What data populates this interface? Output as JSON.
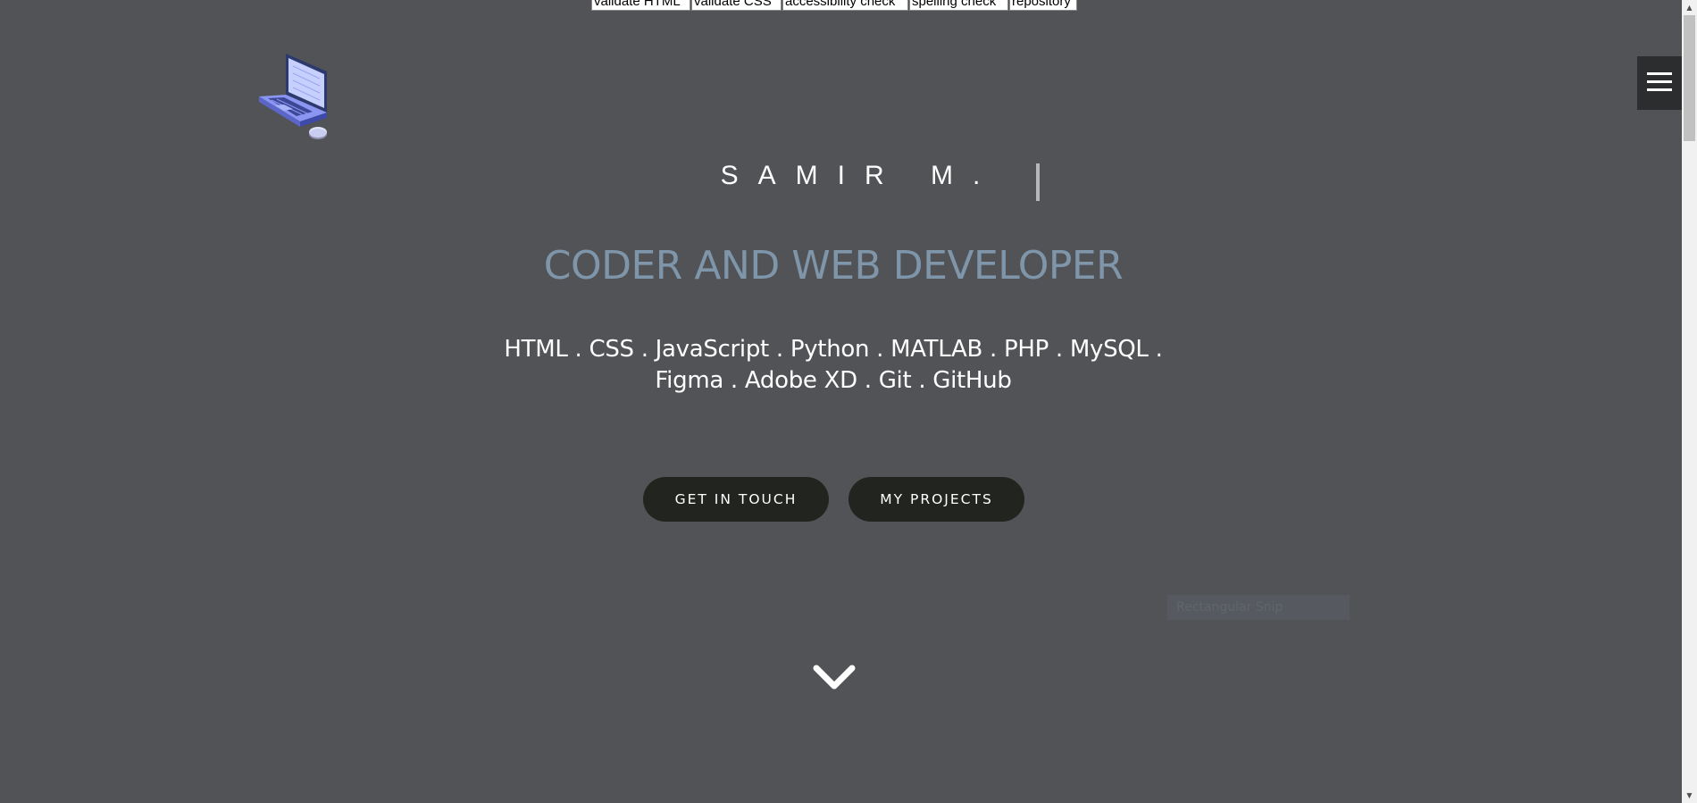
{
  "toolbar": {
    "links": [
      "validate HTML",
      "validate CSS",
      "accessibility check",
      "spelling check",
      "repository"
    ]
  },
  "logo": {
    "icon": "laptop-icon"
  },
  "menu": {
    "icon": "hamburger-icon"
  },
  "hero": {
    "name": "SAMIR M.",
    "subtitle": "CODER AND WEB DEVELOPER",
    "skills": "HTML . CSS . JavaScript . Python . MATLAB . PHP . MySQL . Figma . Adobe XD . Git . GitHub",
    "buttons": {
      "contact_label": "GET IN TOUCH",
      "projects_label": "MY PROJECTS"
    },
    "ghost_label": "Rectangular Snip",
    "scroll_icon": "chevron-down-icon"
  },
  "colors": {
    "background": "#525356",
    "subtitle": "#7e95aa",
    "button": "#222420",
    "menu": "#2b2d2f"
  }
}
